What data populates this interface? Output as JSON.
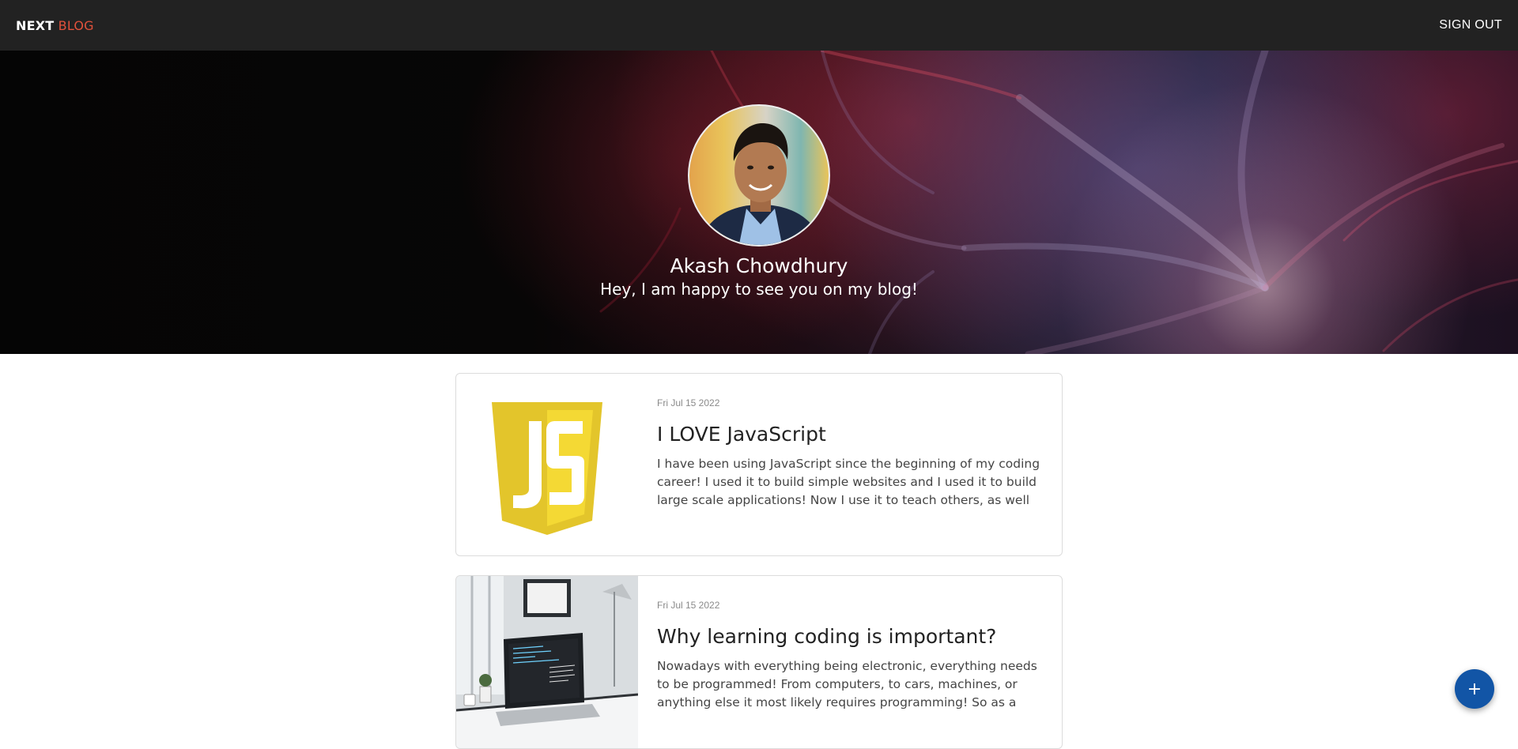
{
  "navbar": {
    "brand_strong": "NEXT",
    "brand_accent": "BLOG",
    "signout_label": "SIGN OUT"
  },
  "hero": {
    "name": "Akash Chowdhury",
    "tagline": "Hey, I am happy to see you on my blog!"
  },
  "posts": [
    {
      "date": "Fri Jul 15 2022",
      "title": "I LOVE JavaScript",
      "excerpt": "I have been using JavaScript since the beginning of my coding career! I used it to build simple websites and I used it to build large scale applications! Now I use it to teach others, as well as create",
      "thumbnail_label": "JS"
    },
    {
      "date": "Fri Jul 15 2022",
      "title": "Why learning coding is important?",
      "excerpt": "Nowadays with everything being electronic, everything needs to be programmed! From computers, to cars, machines, or anything else it most likely requires programming! So as a result, demand for coders"
    }
  ],
  "fab": {
    "icon": "plus-icon",
    "label": "+"
  },
  "colors": {
    "navbar_bg": "#222222",
    "brand_accent": "#e0513b",
    "fab_bg": "#1255a6"
  }
}
